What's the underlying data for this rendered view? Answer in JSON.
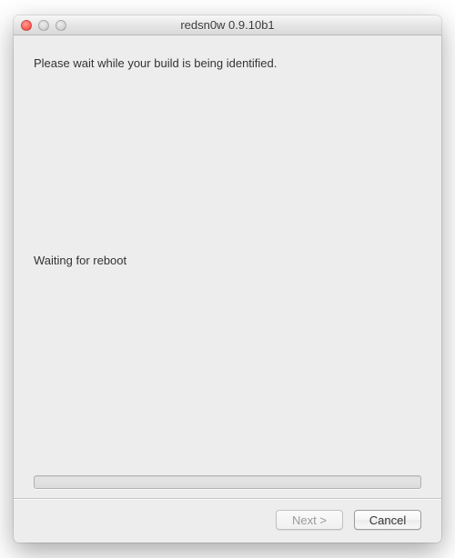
{
  "window": {
    "title": "redsn0w 0.9.10b1"
  },
  "content": {
    "instruction": "Please wait while your build is being identified.",
    "status": "Waiting for reboot"
  },
  "buttons": {
    "next": "Next >",
    "cancel": "Cancel"
  }
}
